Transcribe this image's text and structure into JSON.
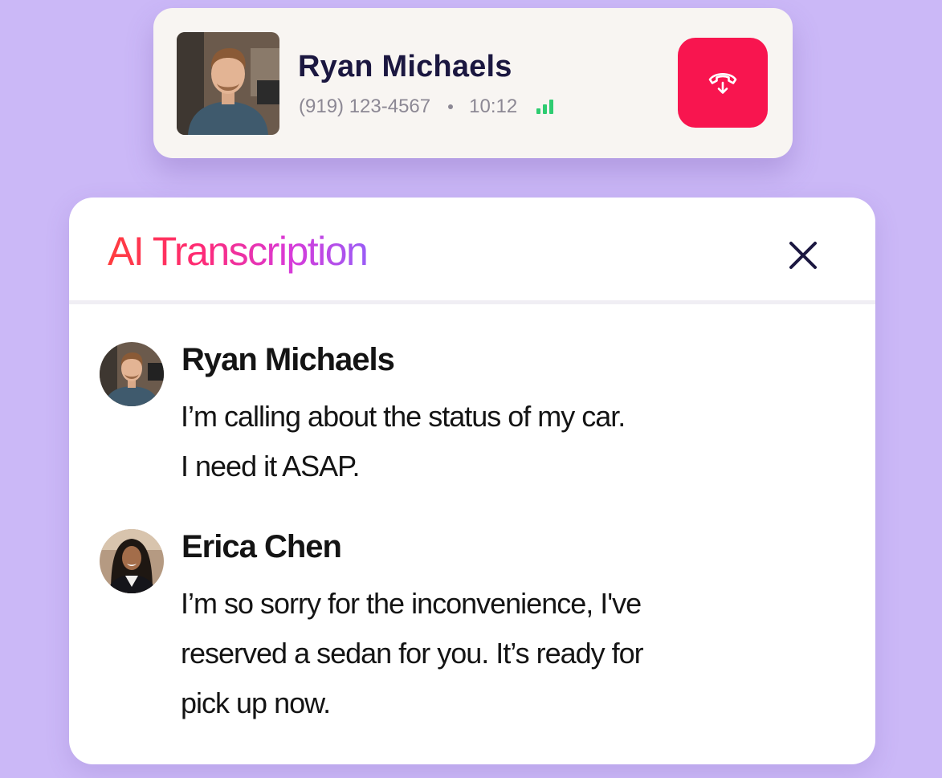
{
  "call": {
    "contact_name": "Ryan Michaels",
    "phone": "(919) 123-4567",
    "duration": "10:12",
    "avatar_icon": "person-photo",
    "signal_icon": "signal-bars-icon",
    "signal_color": "#2ecc71",
    "hangup_icon": "phone-hangup-icon",
    "hangup_color": "#f8154f"
  },
  "transcription": {
    "title": "AI Transcription",
    "close_icon": "close-icon",
    "messages": [
      {
        "speaker": "Ryan Michaels",
        "lines": [
          "I’m calling about the status of my car.",
          "I need it ASAP."
        ]
      },
      {
        "speaker": "Erica Chen",
        "lines": [
          "I’m so sorry for the inconvenience, I've",
          "reserved a sedan for you. It’s ready for",
          "pick up now."
        ]
      }
    ]
  },
  "colors": {
    "background": "#cbb8f7",
    "title_gradient": [
      "#ff3d3d",
      "#ff2a73",
      "#d93ad8",
      "#9a5cf6"
    ]
  }
}
